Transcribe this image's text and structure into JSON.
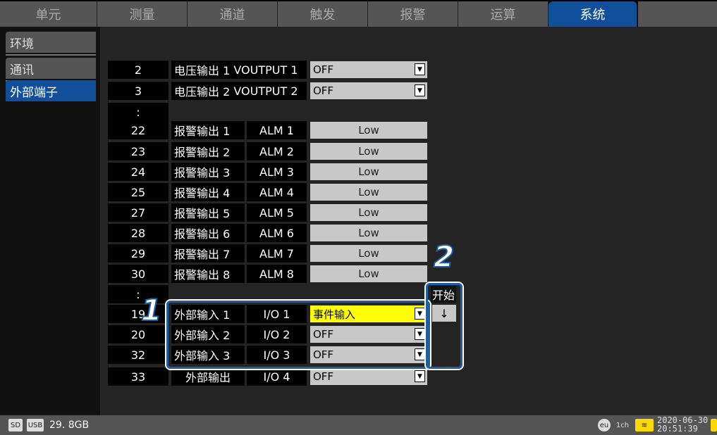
{
  "tabs": [
    {
      "label": "单元"
    },
    {
      "label": "测量"
    },
    {
      "label": "通道"
    },
    {
      "label": "触发"
    },
    {
      "label": "报警"
    },
    {
      "label": "运算"
    },
    {
      "label": "系统"
    }
  ],
  "sidebar": {
    "items": [
      {
        "label": "环境"
      },
      {
        "label": "通讯"
      },
      {
        "label": "外部端子"
      }
    ]
  },
  "rows": {
    "r1": {
      "num": "2",
      "name": "电压输出 1",
      "signal": "VOUTPUT 1",
      "value": "OFF"
    },
    "r2": {
      "num": "3",
      "name": "电压输出 2",
      "signal": "VOUTPUT 2",
      "value": "OFF"
    },
    "ellipsis": ":",
    "alarms": [
      {
        "num": "22",
        "name": "报警输出 1",
        "signal": "ALM 1",
        "value": "Low"
      },
      {
        "num": "23",
        "name": "报警输出 2",
        "signal": "ALM 2",
        "value": "Low"
      },
      {
        "num": "24",
        "name": "报警输出 3",
        "signal": "ALM 3",
        "value": "Low"
      },
      {
        "num": "25",
        "name": "报警输出 4",
        "signal": "ALM 4",
        "value": "Low"
      },
      {
        "num": "27",
        "name": "报警输出 5",
        "signal": "ALM 5",
        "value": "Low"
      },
      {
        "num": "28",
        "name": "报警输出 6",
        "signal": "ALM 6",
        "value": "Low"
      },
      {
        "num": "29",
        "name": "报警输出 7",
        "signal": "ALM 7",
        "value": "Low"
      },
      {
        "num": "30",
        "name": "报警输出 8",
        "signal": "ALM 8",
        "value": "Low"
      }
    ],
    "io": [
      {
        "num": "19",
        "name": "外部输入 1",
        "signal": "I/O 1",
        "value": "事件输入"
      },
      {
        "num": "20",
        "name": "外部输入 2",
        "signal": "I/O 2",
        "value": "OFF"
      },
      {
        "num": "32",
        "name": "外部输入 3",
        "signal": "I/O 3",
        "value": "OFF"
      },
      {
        "num": "33",
        "name": "外部输出",
        "signal": "I/O 4",
        "value": "OFF"
      }
    ]
  },
  "start": {
    "label": "开始",
    "button": "↓"
  },
  "markers": {
    "m1": "1",
    "m2": "2"
  },
  "status": {
    "sd": "SD",
    "usb": "USB",
    "free": "29. 8GB",
    "eu": "eu",
    "ch": "1ch",
    "date": "2020-06-30",
    "time": "20:51:39"
  },
  "colors": {
    "accent": "#124f9b",
    "highlight": "#ffff00"
  }
}
